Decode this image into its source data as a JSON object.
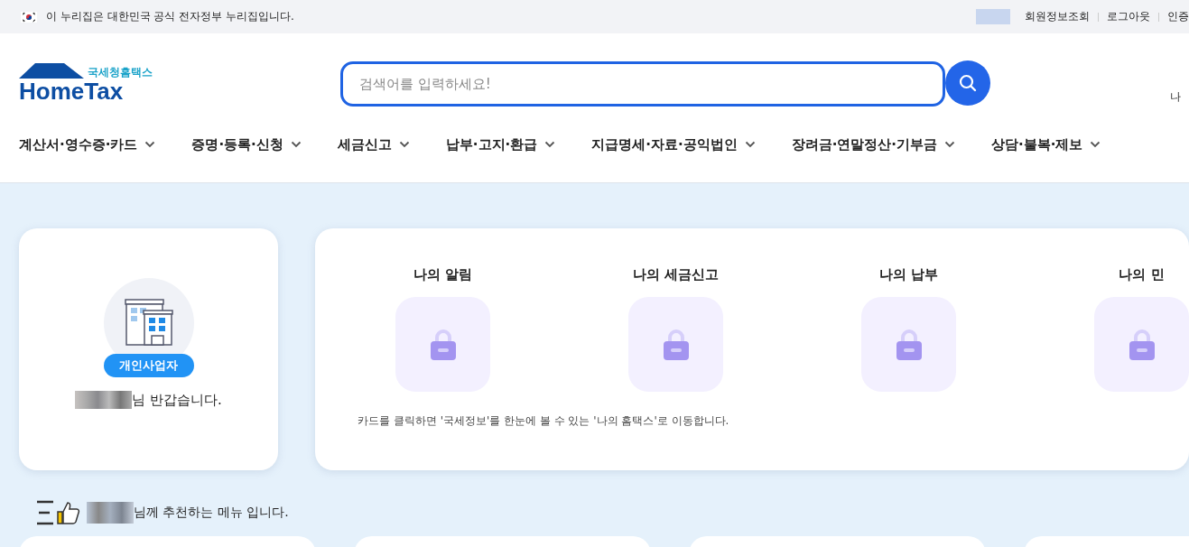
{
  "top_bar": {
    "notice": "이 누리집은 대한민국 공식 전자정부 누리집입니다.",
    "links": [
      "회원정보조회",
      "로그아웃",
      "인증"
    ]
  },
  "logo": {
    "subtitle": "국세청홈택스",
    "name": "HomeTax"
  },
  "search": {
    "placeholder": "검색어를 입력하세요!"
  },
  "side_text": "나",
  "nav": [
    "계산서·영수증·카드",
    "증명·등록·신청",
    "세금신고",
    "납부·고지·환급",
    "지급명세·자료·공익법인",
    "장려금·연말정산·기부금",
    "상담·불복·제보"
  ],
  "profile": {
    "badge": "개인사업자",
    "greeting": "님 반갑습니다."
  },
  "my_cards": [
    {
      "title": "나의 알림",
      "locked": true
    },
    {
      "title": "나의 세금신고",
      "locked": true
    },
    {
      "title": "나의 납부",
      "locked": true
    },
    {
      "title": "나의 민",
      "locked": true
    }
  ],
  "my_cards_hint": "카드를 클릭하면 '국세정보'를 한눈에 볼 수 있는 '나의 홈택스'로 이동합니다.",
  "recommend": {
    "text": "님께 추천하는 메뉴 입니다."
  }
}
